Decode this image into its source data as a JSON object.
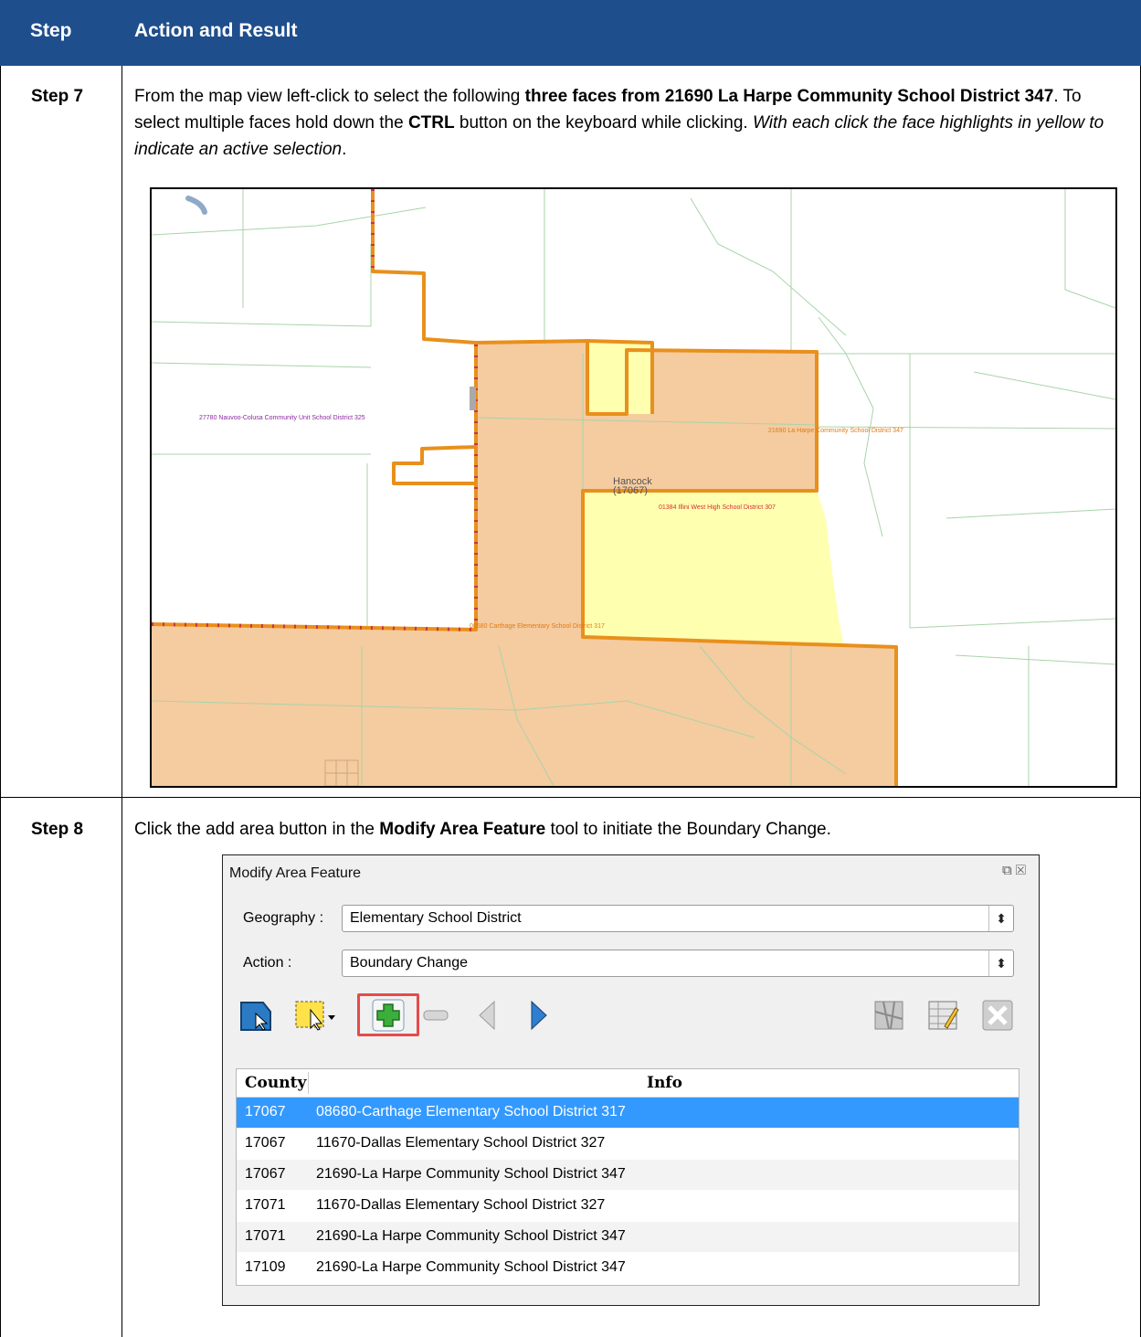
{
  "header": {
    "col_step": "Step",
    "col_action": "Action and Result"
  },
  "step7": {
    "label": "Step 7",
    "text_1": "From the map view left-click to select the following ",
    "bold_1": "three faces from 21690 La Harpe Community School District 347",
    "text_2": ". To select multiple faces hold down the ",
    "bold_2": "CTRL",
    "text_3": " button on the keyboard while clicking. ",
    "italic_1": "With each click the face highlights in yellow to indicate an active selection",
    "text_4": "."
  },
  "map": {
    "labels": {
      "nauvoo": "27780 Nauvoo-Colusa Community Unit School District 325",
      "laharpe": "21690 La Harpe Community School District 347",
      "county_name": "Hancock",
      "county_code": "(17067)",
      "illini": "01384 Illini West High School District 307",
      "carthage": "08680 Carthage Elementary School District 317"
    },
    "colors": {
      "selected_area": "#f5cba0",
      "active_selection": "#ffffb0",
      "boundary": "#e8901c"
    }
  },
  "step8": {
    "label": "Step 8",
    "text_1": "Click the add area button in the ",
    "bold_1": "Modify Area Feature",
    "text_2": " tool to initiate the Boundary Change."
  },
  "dialog": {
    "title": "Modify Area Feature",
    "geography_label": "Geography :",
    "geography_value": "Elementary School District",
    "action_label": "Action :",
    "action_value": "Boundary Change",
    "toolbar_icons": [
      "select-feature-icon",
      "rectangle-select-icon",
      "add-area-icon",
      "remove-area-icon",
      "previous-icon",
      "next-icon",
      "map-icon",
      "edit-table-icon",
      "close-icon"
    ],
    "table": {
      "headers": [
        "County",
        "Info"
      ],
      "rows": [
        {
          "county": "17067",
          "info": "08680-Carthage Elementary School District 317",
          "selected": true
        },
        {
          "county": "17067",
          "info": "11670-Dallas Elementary School District 327"
        },
        {
          "county": "17067",
          "info": "21690-La Harpe Community School District 347"
        },
        {
          "county": "17071",
          "info": "11670-Dallas Elementary School District 327"
        },
        {
          "county": "17071",
          "info": "21690-La Harpe Community School District 347"
        },
        {
          "county": "17109",
          "info": "21690-La Harpe Community School District 347"
        }
      ]
    }
  }
}
